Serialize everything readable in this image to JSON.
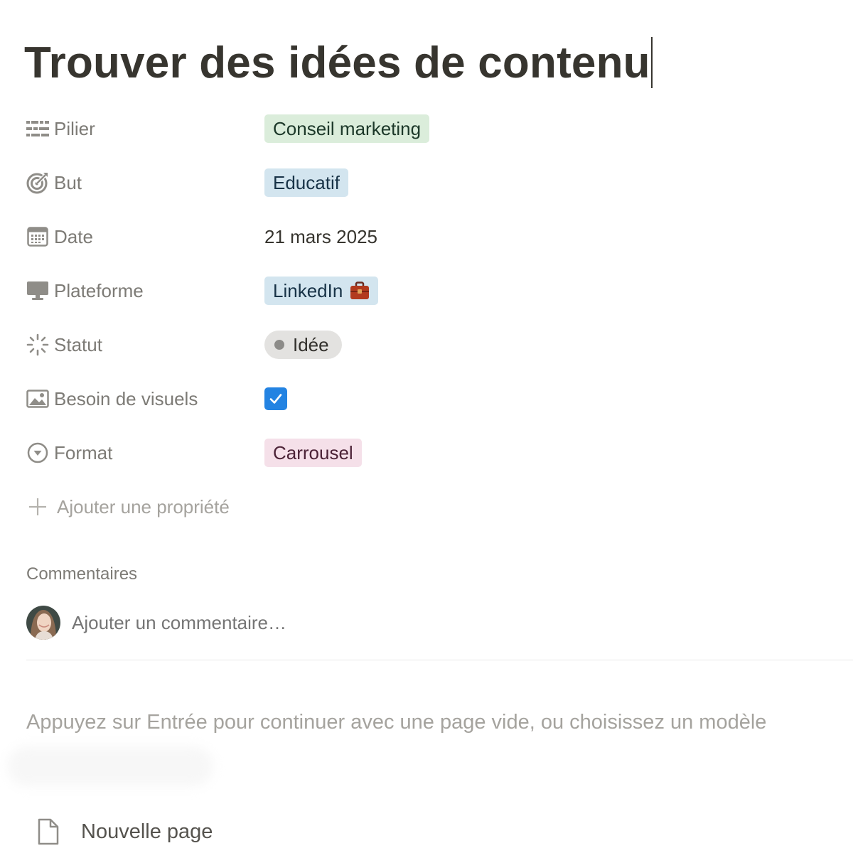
{
  "title": "Trouver des idées de contenu",
  "properties": [
    {
      "label": "Pilier",
      "icon": "multi-select-icon",
      "value": "Conseil marketing",
      "color": "#dbeddb"
    },
    {
      "label": "But",
      "icon": "target-icon",
      "value": "Educatif",
      "color": "#d3e5ef"
    },
    {
      "label": "Date",
      "icon": "calendar-icon",
      "value": "21 mars 2025"
    },
    {
      "label": "Plateforme",
      "icon": "monitor-icon",
      "value": "LinkedIn",
      "emoji": "💼",
      "color": "#d3e5ef"
    },
    {
      "label": "Statut",
      "icon": "status-loader-icon",
      "value": "Idée",
      "color": "#e3e2e0"
    },
    {
      "label": "Besoin de visuels",
      "icon": "image-icon",
      "checked": true,
      "color": "#2383e2"
    },
    {
      "label": "Format",
      "icon": "select-chevron-icon",
      "value": "Carrousel",
      "color": "#f5e0e9"
    }
  ],
  "add_property": "Ajouter une propriété",
  "comments": {
    "title": "Commentaires",
    "placeholder": "Ajouter un commentaire…"
  },
  "hint": "Appuyez sur Entrée pour continuer avec une page vide, ou choisissez un modèle",
  "templates": [
    {
      "label": "Nouvelle page",
      "icon": "page-icon"
    }
  ]
}
